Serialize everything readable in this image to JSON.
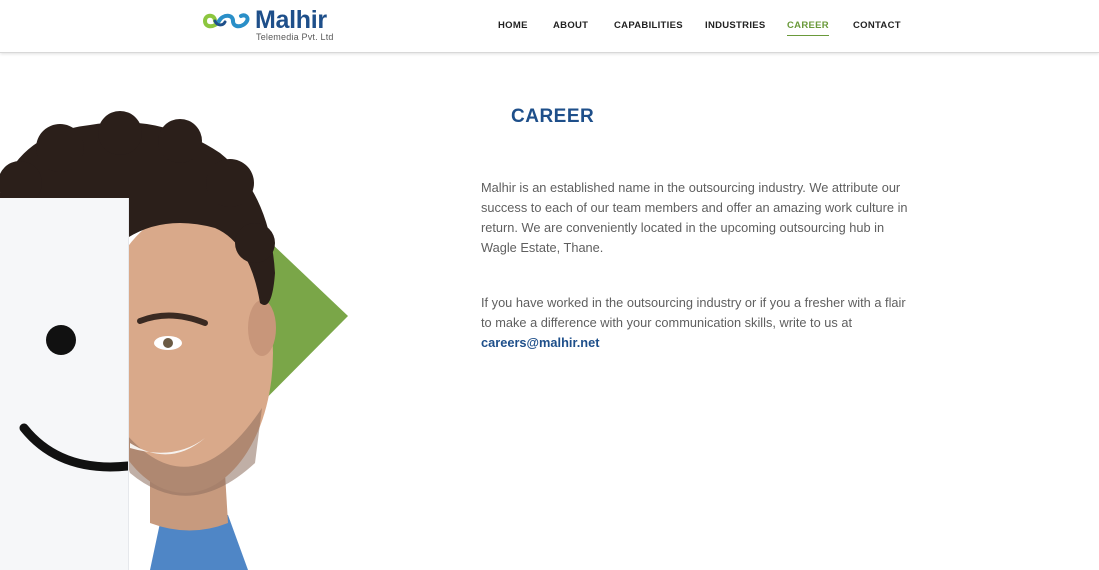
{
  "brand": {
    "name": "Malhir",
    "tagline": "Telemedia Pvt. Ltd",
    "colors": {
      "blue": "#1e4f8a",
      "green": "#6a9a3a"
    }
  },
  "nav": {
    "items": [
      {
        "label": "HOME"
      },
      {
        "label": "ABOUT"
      },
      {
        "label": "CAPABILITIES"
      },
      {
        "label": "INDUSTRIES"
      },
      {
        "label": "CAREER",
        "active": true
      },
      {
        "label": "CONTACT"
      }
    ]
  },
  "content": {
    "title": "CAREER",
    "paragraph1": "Malhir is an established name in the outsourcing industry. We attribute our success to each of our team members and offer an amazing work culture in return. We are conveniently located in the upcoming outsourcing hub in Wagle Estate, Thane.",
    "paragraph2": "If you have worked in the outsourcing industry or if you a fresher with a flair to make a difference with your communication skills, write to us at",
    "email": "careers@malhir.net"
  },
  "hero": {
    "icons": [
      "smiley-card-icon",
      "green-arrow-icon",
      "person-photo"
    ]
  }
}
